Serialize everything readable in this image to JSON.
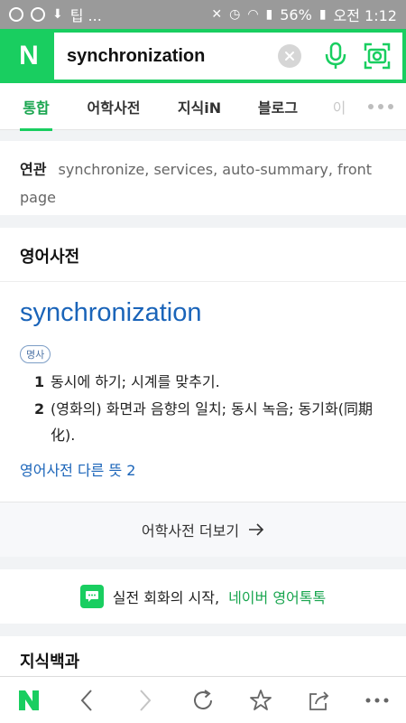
{
  "status_bar": {
    "left_text": "팁 ...",
    "battery_percent": "56%",
    "time": "오전 1:12"
  },
  "search": {
    "logo": "N",
    "query": "synchronization"
  },
  "tabs": [
    {
      "label": "통합"
    },
    {
      "label": "어학사전"
    },
    {
      "label": "지식iN"
    },
    {
      "label": "블로그"
    },
    {
      "label": "이"
    }
  ],
  "related": {
    "label": "연관",
    "text": "synchronize, services, auto-summary, front page"
  },
  "dictionary": {
    "header": "영어사전",
    "word": "synchronization",
    "part_of_speech": "명사",
    "definitions": [
      {
        "num": "1",
        "text": "동시에 하기; 시계를 맞추기."
      },
      {
        "num": "2",
        "text": "(영화의) 화면과 음향의 일치; 동시 녹음; 동기화(同期化)."
      }
    ],
    "more_meanings": "영어사전 다른 뜻 2",
    "see_more": "어학사전 더보기"
  },
  "talk_banner": {
    "prefix": "실전 회화의 시작,",
    "link": "네이버 영어톡톡"
  },
  "jisik_section": {
    "title": "지식백과"
  },
  "colors": {
    "brand_green": "#19ce60",
    "link_blue": "#1a64b9",
    "status_bar_gray": "#9a9a9a"
  },
  "icons": [
    "n-logo",
    "clear-icon",
    "mic-icon",
    "camera-lens-icon",
    "back-icon",
    "forward-icon",
    "refresh-icon",
    "star-icon",
    "share-icon",
    "more-icon"
  ]
}
